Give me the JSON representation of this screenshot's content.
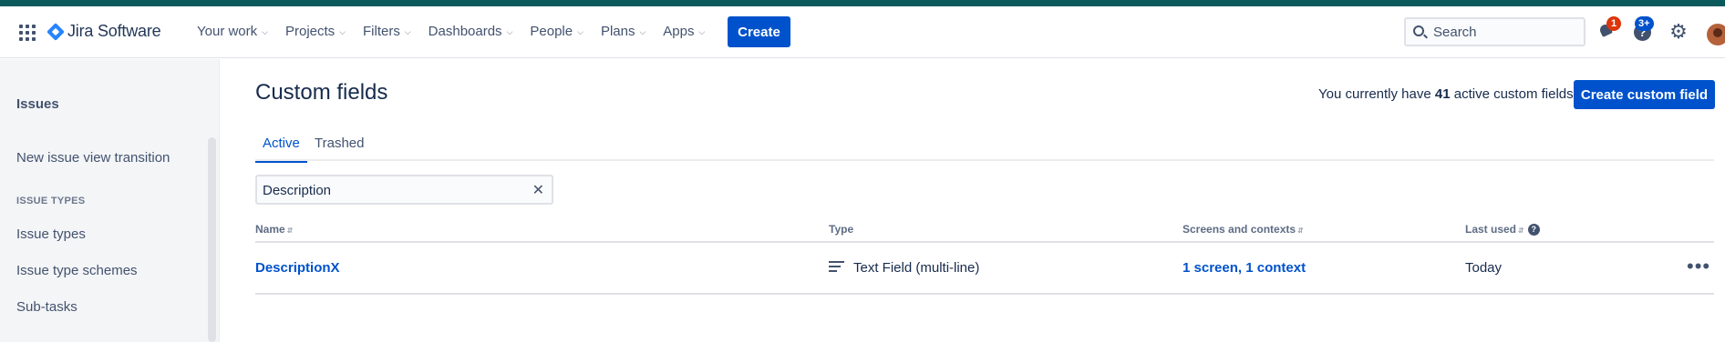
{
  "colors": {
    "brand": "#0052cc",
    "topstrip": "#0a5a5c",
    "badge_red": "#de350b"
  },
  "nav": {
    "app_name": "Jira Software",
    "menu": [
      {
        "label": "Your work"
      },
      {
        "label": "Projects"
      },
      {
        "label": "Filters"
      },
      {
        "label": "Dashboards"
      },
      {
        "label": "People"
      },
      {
        "label": "Plans"
      },
      {
        "label": "Apps"
      }
    ],
    "create_label": "Create",
    "search_placeholder": "Search",
    "notifications_count": "1",
    "help_count": "3+",
    "icons": [
      "app-switcher-icon",
      "jira-logo-icon",
      "search-icon",
      "notification-bell-icon",
      "help-icon",
      "settings-gear-icon",
      "avatar"
    ]
  },
  "sidebar": {
    "heading": "Issues",
    "link_transition": "New issue view transition",
    "group_label": "ISSUE TYPES",
    "links": [
      "Issue types",
      "Issue type schemes",
      "Sub-tasks"
    ]
  },
  "page": {
    "title": "Custom fields",
    "count_prefix": "You currently have",
    "count_value": "41",
    "count_suffix": "active custom fields",
    "create_button": "Create custom field",
    "tabs": [
      {
        "label": "Active",
        "active": true
      },
      {
        "label": "Trashed",
        "active": false
      }
    ],
    "filter_value": "Description",
    "columns": {
      "name": "Name",
      "type": "Type",
      "screens": "Screens and contexts",
      "last_used": "Last used"
    },
    "rows": [
      {
        "name": "DescriptionX",
        "type": "Text Field (multi-line)",
        "screens": "1 screen, 1 context",
        "last_used": "Today"
      }
    ]
  }
}
